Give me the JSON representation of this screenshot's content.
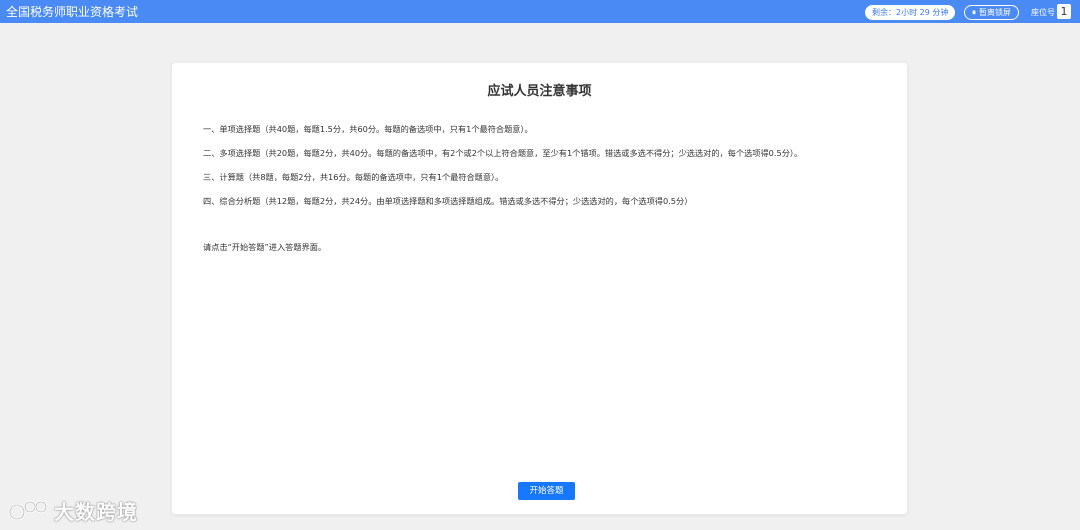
{
  "header": {
    "app_title": "全国税务师职业资格考试",
    "timer_text": "剩余：2小时 29 分钟",
    "pause_label": "暂离锁屏",
    "seat_label": "座位号",
    "seat_value": "1"
  },
  "main": {
    "title": "应试人员注意事项",
    "rules": [
      "一、单项选择题（共40题，每题1.5分，共60分。每题的备选项中，只有1个最符合题意）。",
      "二、多项选择题（共20题，每题2分，共40分。每题的备选项中，有2个或2个以上符合题意，至少有1个错项。错选或多选不得分；少选选对的，每个选项得0.5分）。",
      "三、计算题（共8题，每题2分，共16分。每题的备选项中，只有1个最符合题意）。",
      "四、综合分析题（共12题，每题2分，共24分。由单项选择题和多项选择题组成。错选或多选不得分；少选选对的，每个选项得0.5分）"
    ],
    "prompt": "请点击“开始答题”进入答题界面。",
    "start_button": "开始答题"
  },
  "watermark": {
    "text": "大数跨境"
  },
  "colors": {
    "topbar": "#4a8af4",
    "button": "#1677ff",
    "background": "#f0f0f0"
  }
}
